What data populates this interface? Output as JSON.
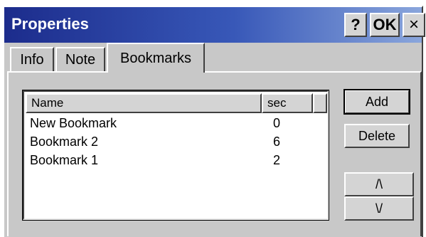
{
  "window": {
    "title": "Properties",
    "buttons": {
      "help": "?",
      "ok": "OK",
      "close": "×"
    }
  },
  "tabs": [
    {
      "label": "Info"
    },
    {
      "label": "Note"
    },
    {
      "label": "Bookmarks",
      "selected": true
    }
  ],
  "bookmarks": {
    "columns": {
      "name": "Name",
      "sec": "sec"
    },
    "rows": [
      {
        "name": "New Bookmark",
        "sec": "0"
      },
      {
        "name": "Bookmark 2",
        "sec": "6"
      },
      {
        "name": "Bookmark 1",
        "sec": "2"
      }
    ]
  },
  "actions": {
    "add": "Add",
    "delete": "Delete",
    "move_up": "/\\",
    "move_down": "\\/"
  }
}
